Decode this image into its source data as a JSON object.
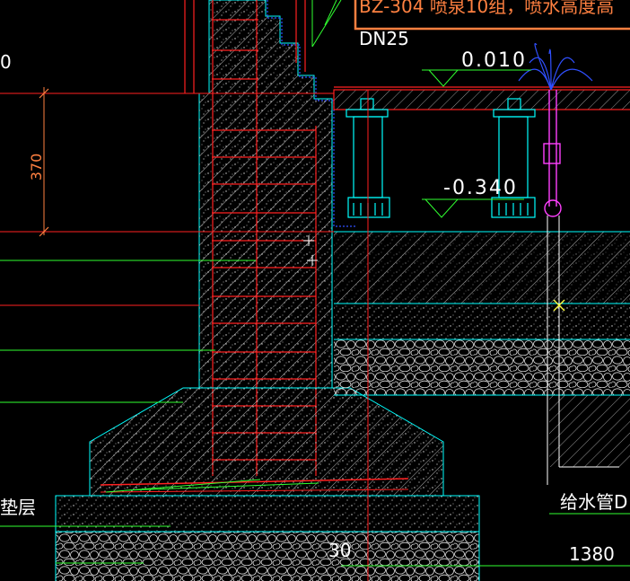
{
  "texts": {
    "top_note": "BZ-304 喷泉10组，喷水高度高",
    "pipe_dn": "DN25",
    "elev_top": "0.010",
    "elev_low": "-0.340",
    "dim_370": "370",
    "left_zero": "0",
    "left_layer": "垫层",
    "supply_pipe": "给水管D",
    "dim_30": "30",
    "dim_1380": "1380"
  },
  "colors": {
    "background": "#000000",
    "cyan": "#00ffff",
    "red": "#ff2020",
    "green": "#30ff30",
    "orange": "#ff8040",
    "blue": "#3050ff",
    "magenta": "#ff40ff",
    "white": "#ffffff",
    "yellow": "#ffff40"
  }
}
